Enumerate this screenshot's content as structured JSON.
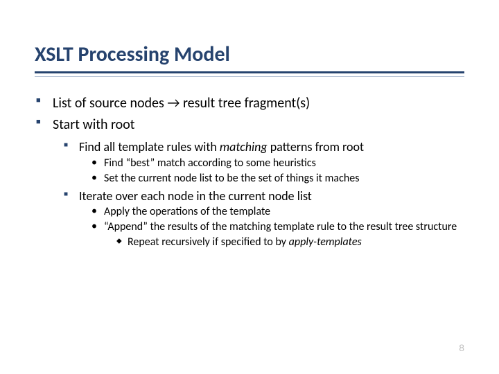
{
  "title": "XSLT Processing Model",
  "bullets": {
    "b1_pre": "List of source nodes",
    "b1_arrow": " → ",
    "b1_post": "result tree fragment(s)",
    "b2": "Start with root",
    "b2_1_pre": "Find all template rules with ",
    "b2_1_italic": "matching",
    "b2_1_post": " patterns from root",
    "b2_1_a": "Find “best” match according to some heuristics",
    "b2_1_b": "Set the current node list to be the set of things it maches",
    "b2_2": "Iterate over each node in the current node list",
    "b2_2_a": "Apply the operations of the template",
    "b2_2_b": "“Append” the results of the matching template rule to the result tree structure",
    "b2_2_b_i_pre": "Repeat recursively if specified to by ",
    "b2_2_b_i_italic": "apply-templates"
  },
  "page_number": "8"
}
